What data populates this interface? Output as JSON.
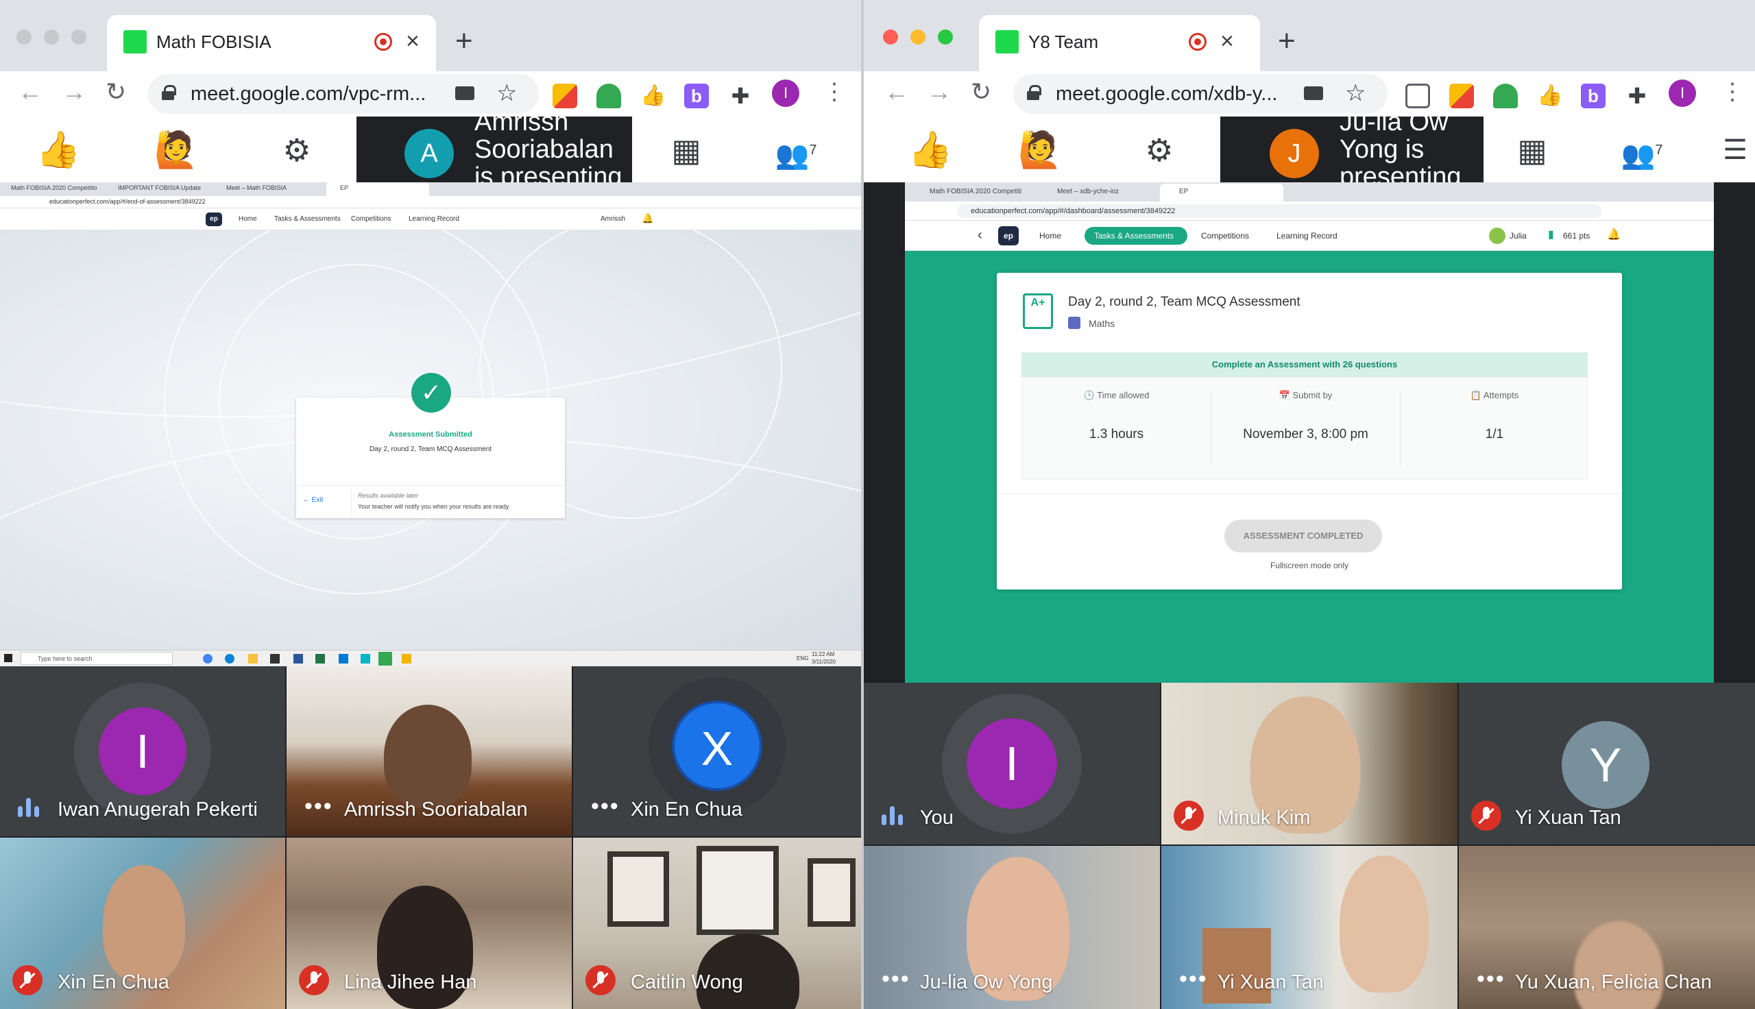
{
  "left_window": {
    "tab_title": "Math FOBISIA",
    "url": "meet.google.com/vpc-rm...",
    "presenter": {
      "initial": "A",
      "text": "Amrissh Sooriabalan is presenting",
      "color": "#129eaf"
    },
    "participants_badge": "7",
    "shared_screen": {
      "tabs": [
        "Math FOBISIA 2020 Competitio",
        "IMPORTANT FOBISIA Update",
        "Meet – Math FOBISIA",
        "EP"
      ],
      "url": "educationperfect.com/app/#/end-of-assessment/3849222",
      "nav": [
        "Home",
        "Tasks & Assessments",
        "Competitions",
        "Learning Record"
      ],
      "user": "Amrissh",
      "submitted_title": "Assessment Submitted",
      "assessment_name": "Day 2, round 2, Team MCQ Assessment",
      "exit_label": "Exit",
      "results_label": "Results available later",
      "results_note": "Your teacher will notify you when your results are ready.",
      "taskbar_search": "Type here to search",
      "taskbar_time": "11:22 AM",
      "taskbar_date": "3/11/2020",
      "taskbar_lang": "ENG"
    },
    "tiles": [
      {
        "name": "Iwan Anugerah Pekerti",
        "status": "speaking",
        "avatar": "I",
        "avatar_color": "#9c27b0"
      },
      {
        "name": "Amrissh Sooriabalan",
        "status": "more",
        "video": true
      },
      {
        "name": "Xin En Chua",
        "status": "more",
        "avatar": "X",
        "avatar_color": "#1a73e8"
      },
      {
        "name": "Xin En Chua",
        "status": "muted",
        "video": true
      },
      {
        "name": "Lina Jihee Han",
        "status": "muted",
        "video": true
      },
      {
        "name": "Caitlin Wong",
        "status": "muted",
        "video": true
      }
    ]
  },
  "right_window": {
    "tab_title": "Y8 Team",
    "url": "meet.google.com/xdb-y...",
    "presenter": {
      "initial": "J",
      "text": "Ju-lia Ow Yong is presenting",
      "color": "#e8710a"
    },
    "participants_badge": "7",
    "shared_screen": {
      "tabs": [
        "Math FOBISIA 2020 Competiti",
        "Meet – xdb-yche-ioz",
        "EP"
      ],
      "url": "educationperfect.com/app/#/dashboard/assessment/3849222",
      "nav": [
        "Home",
        "Tasks & Assessments",
        "Competitions",
        "Learning Record"
      ],
      "active_nav": "Tasks & Assessments",
      "user": "Julia",
      "points": "661 pts",
      "assessment_title": "Day 2, round 2, Team MCQ Assessment",
      "subject": "Maths",
      "banner": "Complete an Assessment with 26 questions",
      "stats": [
        {
          "label": "Time allowed",
          "value": "1.3 hours"
        },
        {
          "label": "Submit by",
          "value": "November 3, 8:00 pm"
        },
        {
          "label": "Attempts",
          "value": "1/1"
        }
      ],
      "completed_button": "ASSESSMENT COMPLETED",
      "fullscreen_note": "Fullscreen mode only"
    },
    "tiles": [
      {
        "name": "You",
        "status": "speaking",
        "avatar": "I",
        "avatar_color": "#9c27b0"
      },
      {
        "name": "Minuk Kim",
        "status": "muted",
        "video": true
      },
      {
        "name": "Yi Xuan Tan",
        "status": "muted",
        "avatar": "Y",
        "avatar_color": "#78909c"
      },
      {
        "name": "Ju-lia Ow Yong",
        "status": "more",
        "video": true
      },
      {
        "name": "Yi Xuan Tan",
        "status": "more",
        "video": true
      },
      {
        "name": "Yu Xuan, Felicia Chan",
        "status": "more",
        "video": true
      }
    ]
  },
  "colors": {
    "ep_green": "#1aa784",
    "chrome_tabstrip": "#dee1e6",
    "meet_dark": "#202124",
    "mic_red": "#d93025"
  }
}
